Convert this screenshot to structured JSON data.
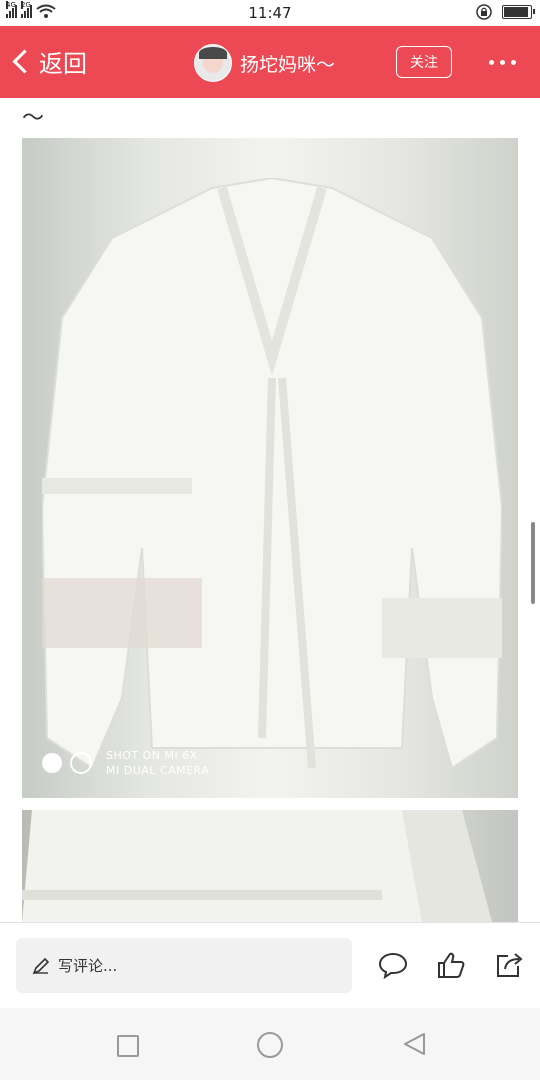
{
  "status_bar": {
    "time": "11:47",
    "network_1": "4G",
    "network_2": "2G"
  },
  "header": {
    "back_label": "返回",
    "author_name": "扬坨妈咪～",
    "follow_label": "关注",
    "accent_color": "#ec4955"
  },
  "content": {
    "text_fragment": "～",
    "photo_watermark_line1": "SHOT ON MI 6X",
    "photo_watermark_line2": "MI DUAL CAMERA"
  },
  "comment_bar": {
    "placeholder": "写评论..."
  },
  "icons": [
    "chevron-left-icon",
    "more-icon",
    "pencil-icon",
    "comment-icon",
    "like-icon",
    "share-icon",
    "recent-apps-icon",
    "home-icon",
    "back-nav-icon"
  ]
}
